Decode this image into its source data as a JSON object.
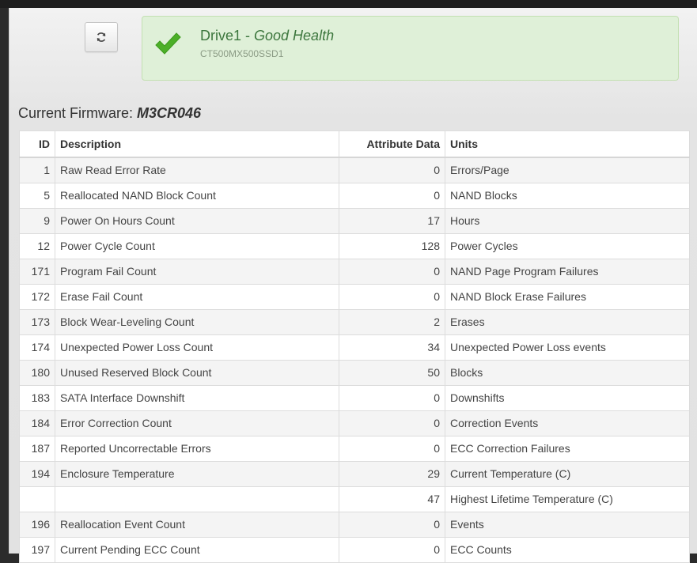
{
  "drive": {
    "name": "Drive1",
    "separator": " - ",
    "status": "Good Health",
    "model": "CT500MX500SSD1",
    "status_color": "#3c763d"
  },
  "firmware": {
    "label": "Current Firmware: ",
    "value": "M3CR046"
  },
  "table": {
    "headers": {
      "id": "ID",
      "description": "Description",
      "attribute": "Attribute Data",
      "units": "Units"
    },
    "rows": [
      {
        "id": "1",
        "description": "Raw Read Error Rate",
        "value": "0",
        "unit": "Errors/Page"
      },
      {
        "id": "5",
        "description": "Reallocated NAND Block Count",
        "value": "0",
        "unit": "NAND Blocks"
      },
      {
        "id": "9",
        "description": "Power On Hours Count",
        "value": "17",
        "unit": "Hours"
      },
      {
        "id": "12",
        "description": "Power Cycle Count",
        "value": "128",
        "unit": "Power Cycles"
      },
      {
        "id": "171",
        "description": "Program Fail Count",
        "value": "0",
        "unit": "NAND Page Program Failures"
      },
      {
        "id": "172",
        "description": "Erase Fail Count",
        "value": "0",
        "unit": "NAND Block Erase Failures"
      },
      {
        "id": "173",
        "description": "Block Wear-Leveling Count",
        "value": "2",
        "unit": "Erases"
      },
      {
        "id": "174",
        "description": "Unexpected Power Loss Count",
        "value": "34",
        "unit": "Unexpected Power Loss events"
      },
      {
        "id": "180",
        "description": "Unused Reserved Block Count",
        "value": "50",
        "unit": "Blocks"
      },
      {
        "id": "183",
        "description": "SATA Interface Downshift",
        "value": "0",
        "unit": "Downshifts"
      },
      {
        "id": "184",
        "description": "Error Correction Count",
        "value": "0",
        "unit": "Correction Events"
      },
      {
        "id": "187",
        "description": "Reported Uncorrectable Errors",
        "value": "0",
        "unit": "ECC Correction Failures"
      },
      {
        "id": "194",
        "description": "Enclosure Temperature",
        "value": "29",
        "unit": "Current Temperature (C)"
      },
      {
        "id": "",
        "description": "",
        "value": "47",
        "unit": "Highest Lifetime Temperature (C)"
      },
      {
        "id": "196",
        "description": "Reallocation Event Count",
        "value": "0",
        "unit": "Events"
      },
      {
        "id": "197",
        "description": "Current Pending ECC Count",
        "value": "0",
        "unit": "ECC Counts"
      }
    ]
  },
  "icons": {
    "refresh": "refresh-icon",
    "status": "checkmark-icon"
  }
}
